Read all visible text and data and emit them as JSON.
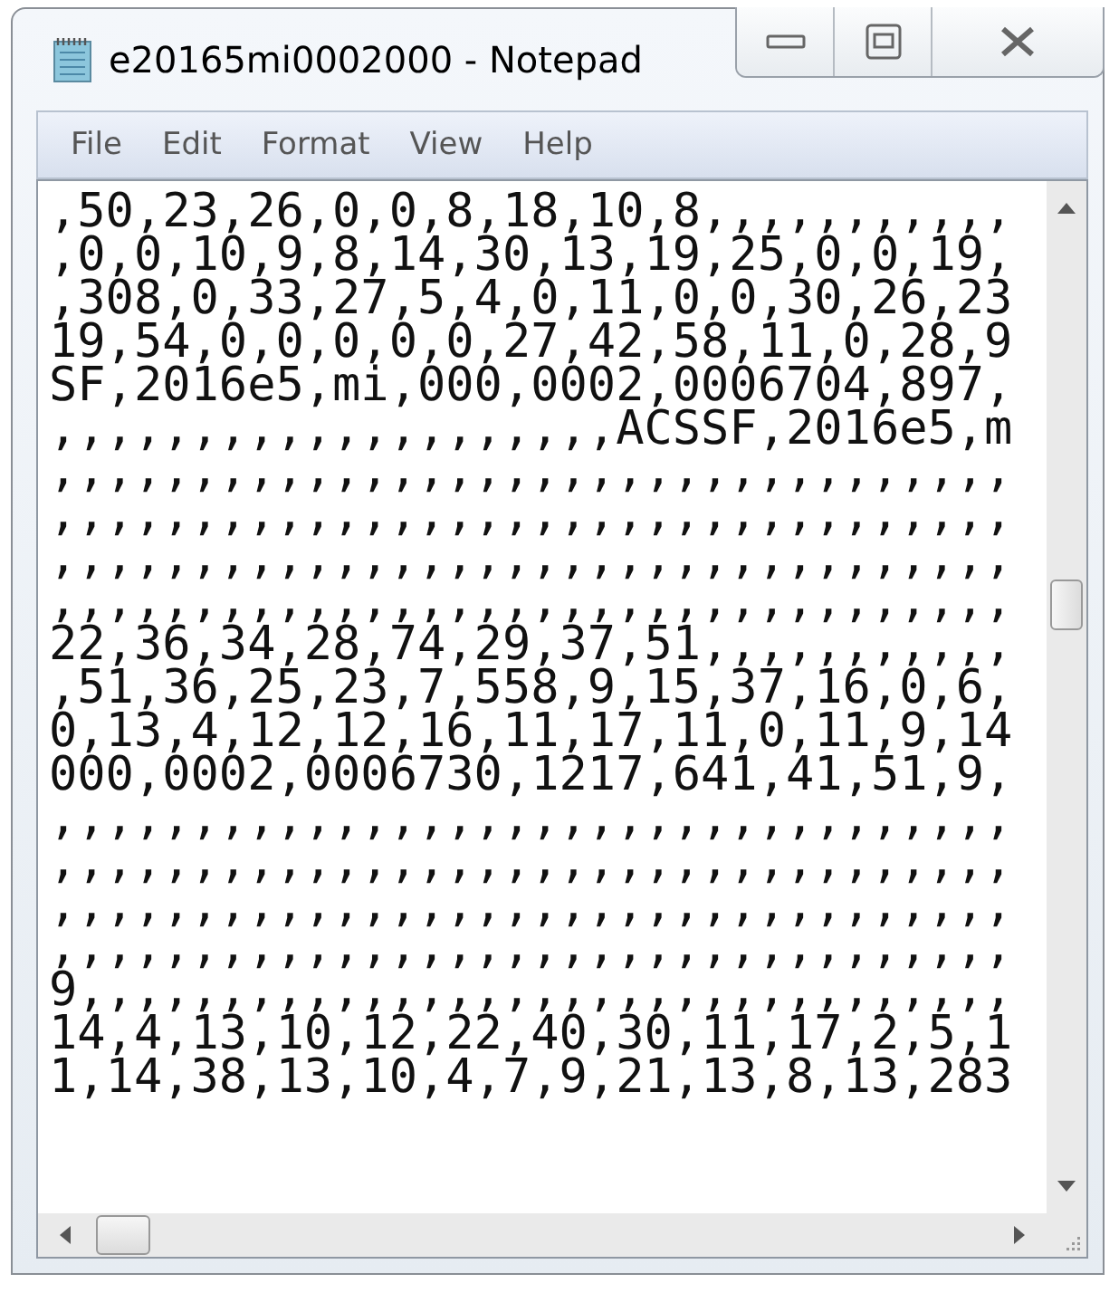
{
  "window": {
    "title": "e20165mi0002000 - Notepad"
  },
  "menu": [
    "File",
    "Edit",
    "Format",
    "View",
    "Help"
  ],
  "editor": {
    "lines": [
      ",50,23,26,0,0,8,18,10,8,,,,,,,,,,,",
      ",0,0,10,9,8,14,30,13,19,25,0,0,19,",
      ",308,0,33,27,5,4,0,11,0,0,30,26,23",
      "19,54,0,0,0,0,0,27,42,58,11,0,28,9",
      "SF,2016e5,mi,000,0002,0006704,897,",
      ",,,,,,,,,,,,,,,,,,,,ACSSF,2016e5,m",
      ",,,,,,,,,,,,,,,,,,,,,,,,,,,,,,,,,,",
      ",,,,,,,,,,,,,,,,,,,,,,,,,,,,,,,,,,",
      ",,,,,,,,,,,,,,,,,,,,,,,,,,,,,,,,,,",
      ",,,,,,,,,,,,,,,,,,,,,,,,,,,,,,,,,,",
      "22,36,34,28,74,29,37,51,,,,,,,,,,,",
      ",51,36,25,23,7,558,9,15,37,16,0,6,",
      "0,13,4,12,12,16,11,17,11,0,11,9,14",
      "000,0002,0006730,1217,641,41,51,9,",
      ",,,,,,,,,,,,,,,,,,,,,,,,,,,,,,,,,,",
      ",,,,,,,,,,,,,,,,,,,,,,,,,,,,,,,,,,",
      ",,,,,,,,,,,,,,,,,,,,,,,,,,,,,,,,,,",
      ",,,,,,,,,,,,,,,,,,,,,,,,,,,,,,,,,,",
      "9,,,,,,,,,,,,,,,,,,,,,,,,,,,,,,,,,",
      "14,4,13,10,12,22,40,30,11,17,2,5,1",
      "1,14,38,13,10,4,7,9,21,13,8,13,283"
    ]
  }
}
